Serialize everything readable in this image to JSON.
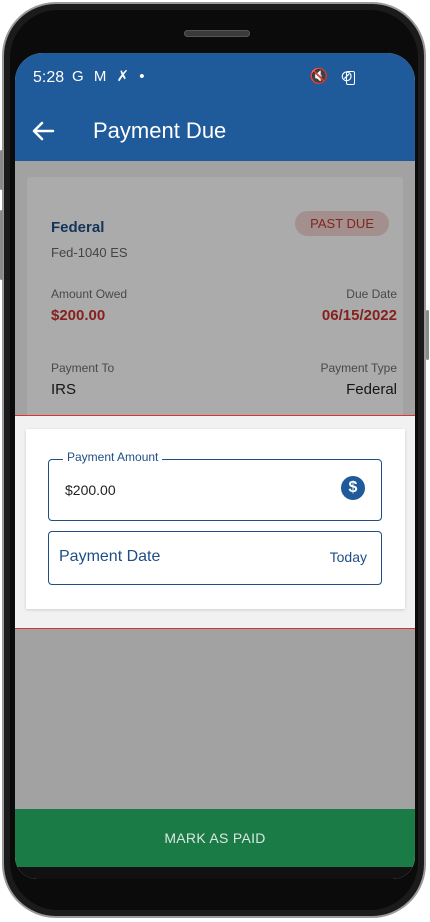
{
  "status_bar": {
    "time": "5:28",
    "left_icons": "G M ✗ •",
    "right_icons": "🔇 ⊘"
  },
  "app_bar": {
    "title": "Payment Due"
  },
  "summary": {
    "category": "Federal",
    "form": "Fed-1040 ES",
    "badge": "PAST DUE",
    "amount_owed_label": "Amount Owed",
    "amount_owed": "$200.00",
    "due_date_label": "Due Date",
    "due_date": "06/15/2022",
    "payment_to_label": "Payment To",
    "payment_to": "IRS",
    "payment_type_label": "Payment Type",
    "payment_type": "Federal"
  },
  "form": {
    "payment_amount_label": "Payment Amount",
    "payment_amount_value": "$200.00",
    "payment_date_label": "Payment Date",
    "payment_date_value": "Today"
  },
  "footer": {
    "mark_as_paid": "MARK AS PAID"
  },
  "colors": {
    "primary": "#1f5a9a",
    "success": "#1f8a4f",
    "danger": "#c8322e"
  },
  "icons": [
    "back-arrow-icon",
    "dollar-icon",
    "mute-icon",
    "wifi-icon",
    "dnd-icon",
    "battery-icon"
  ]
}
